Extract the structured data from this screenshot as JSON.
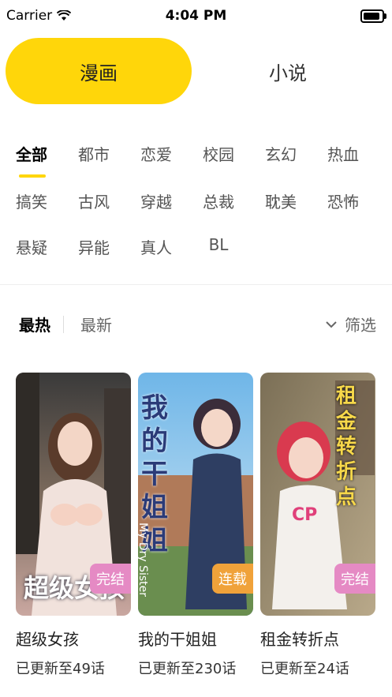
{
  "status_bar": {
    "carrier": "Carrier",
    "time": "4:04 PM",
    "battery_level": 0.92
  },
  "segment": {
    "active_label": "漫画",
    "inactive_label": "小说"
  },
  "categories": [
    "全部",
    "都市",
    "恋爱",
    "校园",
    "玄幻",
    "热血",
    "搞笑",
    "古风",
    "穿越",
    "总裁",
    "耽美",
    "恐怖",
    "悬疑",
    "异能",
    "真人",
    "BL"
  ],
  "category_selected": "全部",
  "sort": {
    "hot": "最热",
    "new": "最新",
    "filter": "筛选"
  },
  "items": [
    {
      "cover_text": "超级女孩",
      "badge": "完结",
      "title": "超级女孩",
      "subtitle": "已更新至49话"
    },
    {
      "cover_text": "我的干姐姐",
      "cover_subtext": "My Dry Sister",
      "badge": "连载",
      "title": "我的干姐姐",
      "subtitle": "已更新至230话"
    },
    {
      "cover_text": "租金转折点",
      "cover_badge_label": "CP",
      "badge": "完结",
      "title": "租金转折点",
      "subtitle": "已更新至24话"
    }
  ],
  "colors": {
    "accent": "#FFD60A",
    "badge_done": "#E58AC4",
    "badge_ongoing": "#F0A23A"
  }
}
